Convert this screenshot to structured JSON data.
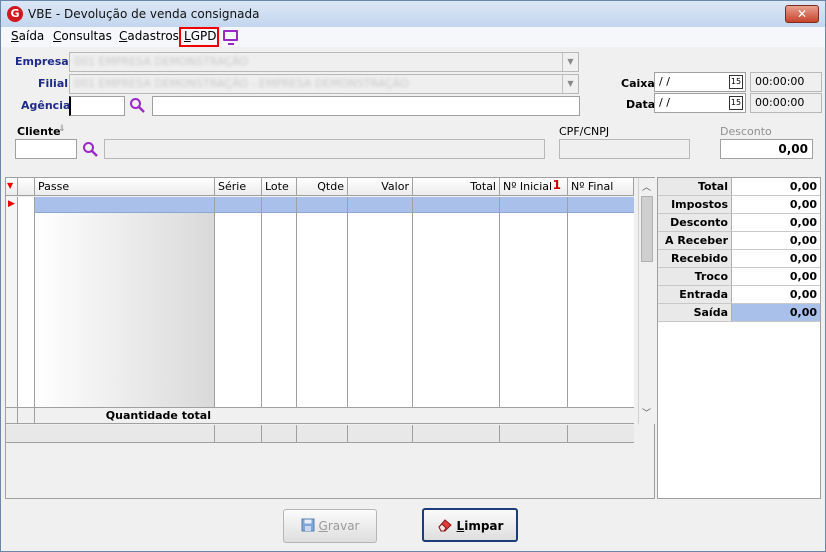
{
  "window": {
    "title": "VBE - Devolução de venda consignada",
    "close": "✕"
  },
  "menu": [
    {
      "label": "Saída",
      "ul": "S",
      "rest": "aída"
    },
    {
      "label": "Consultas",
      "ul": "C",
      "rest": "onsultas"
    },
    {
      "label": "Cadastros",
      "ul": "C",
      "rest": "adastros"
    },
    {
      "label": "LGPD",
      "ul": "L",
      "rest": "GPD"
    }
  ],
  "form": {
    "empresa_label": "Empresa",
    "empresa_value": "001 EMPRESA DEMONSTRAÇÃO",
    "filial_label": "Filial",
    "filial_value": "001 EMPRESA DEMONSTRAÇÃO - EMPRESA DEMONSTRAÇÃO",
    "agencia_label": "Agência",
    "agencia_value": "",
    "caixa_label": "Caixa",
    "caixa_date": " / /",
    "caixa_time": "00:00:00",
    "data_label": "Data",
    "data_date": " / /",
    "data_time": "00:00:00",
    "cal_icon": "15",
    "cliente_label": "Cliente",
    "cpf_label": "CPF/CNPJ",
    "desconto_label": "Desconto",
    "desconto_value": "0,00"
  },
  "grid": {
    "columns": [
      "Passe",
      "Série",
      "Lote",
      "Qtde",
      "Valor",
      "Total",
      "Nº Inicial",
      "Nº Final"
    ],
    "sort_icon": "1",
    "total_label": "Quantidade total"
  },
  "summary": [
    {
      "label": "Total",
      "value": "0,00"
    },
    {
      "label": "Impostos",
      "value": "0,00"
    },
    {
      "label": "Desconto",
      "value": "0,00"
    },
    {
      "label": "A Receber",
      "value": "0,00"
    },
    {
      "label": "Recebido",
      "value": "0,00"
    },
    {
      "label": "Troco",
      "value": "0,00"
    },
    {
      "label": "Entrada",
      "value": "0,00"
    },
    {
      "label": "Saída",
      "value": "0,00"
    }
  ],
  "buttons": {
    "gravar_ul": "G",
    "gravar_rest": "ravar",
    "limpar_ul": "L",
    "limpar_rest": "impar"
  },
  "colors": {
    "accent": "#1e2a8a",
    "selected_row": "#a8c0ea",
    "lgpd_highlight": "#ee0000",
    "search_icon": "#9b27c9"
  }
}
